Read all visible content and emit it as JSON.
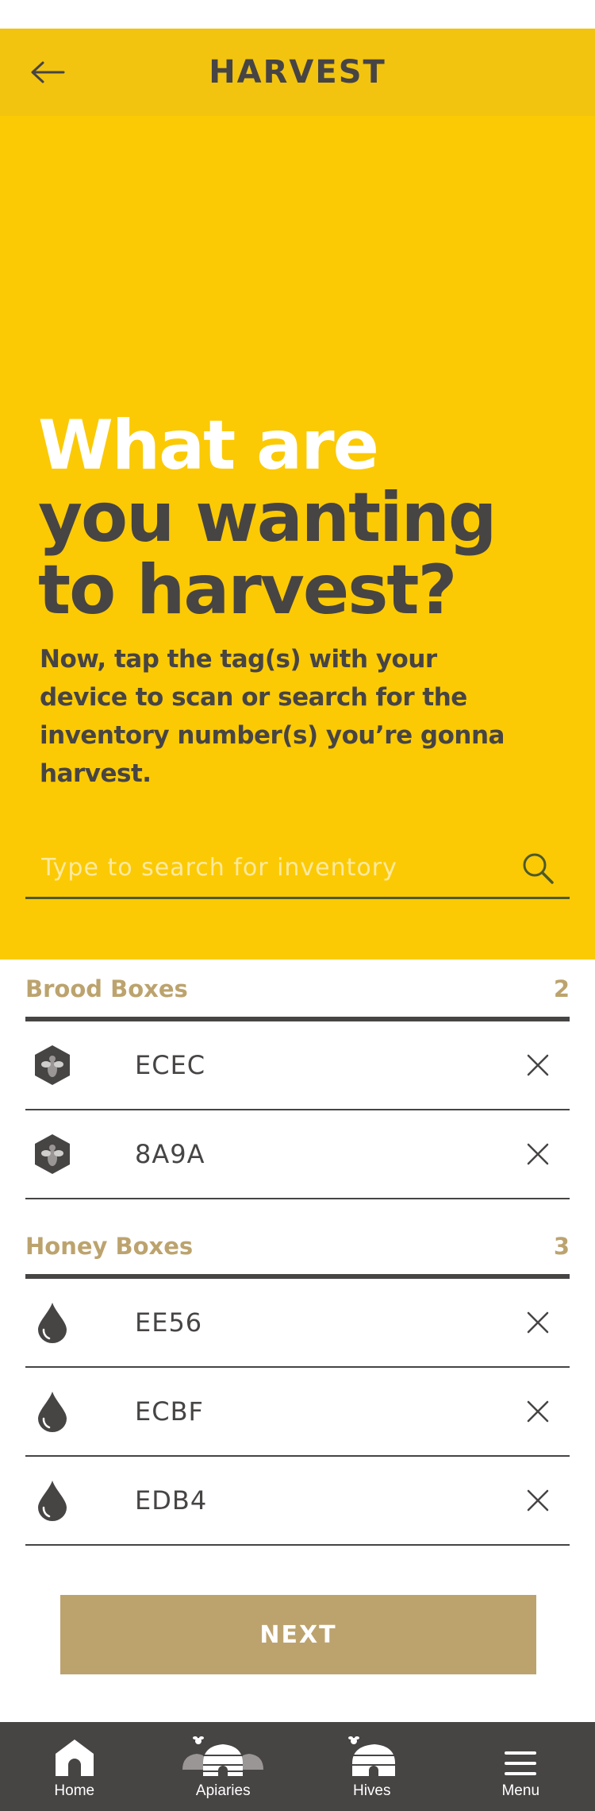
{
  "header": {
    "title": "HARVEST",
    "back_icon": "arrow-left-icon"
  },
  "hero": {
    "title_line1": "What are",
    "title_line2": "you wanting",
    "title_line3": "to harvest?",
    "subtitle": "Now, tap the tag(s) with your device to scan or search for the inventory number(s) you’re gonna harvest."
  },
  "search": {
    "placeholder": "Type to search for inventory",
    "value": "",
    "icon": "search-icon"
  },
  "brood": {
    "label": "Brood Boxes",
    "count": "2",
    "icon": "bee-hexagon-icon",
    "items": [
      {
        "code": "ECEC"
      },
      {
        "code": "8A9A"
      }
    ]
  },
  "honey": {
    "label": "Honey Boxes",
    "count": "3",
    "icon": "honey-drop-icon",
    "items": [
      {
        "code": "EE56"
      },
      {
        "code": "ECBF"
      },
      {
        "code": "EDB4"
      }
    ]
  },
  "next_label": "NEXT",
  "tabs": [
    {
      "label": "Home",
      "icon": "home-icon"
    },
    {
      "label": "Apiaries",
      "icon": "apiaries-icon"
    },
    {
      "label": "Hives",
      "icon": "hive-icon"
    },
    {
      "label": "Menu",
      "icon": "menu-icon"
    }
  ],
  "colors": {
    "header": "#f2c40f",
    "hero": "#fbca05",
    "text": "#474444",
    "accent": "#bca36e",
    "tabbar": "#474444"
  }
}
